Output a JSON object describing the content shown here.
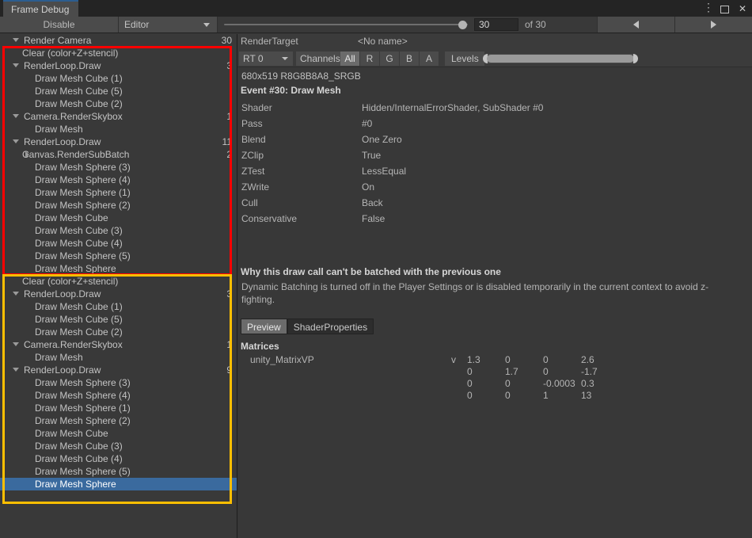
{
  "window": {
    "tab_label": "Frame Debug",
    "controls": [
      {
        "name": "more-options",
        "glyph": "⋮"
      },
      {
        "name": "maximize",
        "glyph": "□"
      },
      {
        "name": "close",
        "glyph": "✕"
      }
    ]
  },
  "toolbar": {
    "disable_label": "Disable",
    "target_dropdown": "Editor",
    "frame_value": "30",
    "frame_total_label": "of 30",
    "prev_label": "◀",
    "next_label": "▶"
  },
  "tree": {
    "rows": [
      {
        "label": "Render Camera",
        "count": "30",
        "indent": 0,
        "arrow": "down",
        "selected": false,
        "box": "none"
      },
      {
        "label": "Clear (color+Z+stencil)",
        "count": "",
        "indent": 1,
        "arrow": "none",
        "selected": false,
        "box": "red"
      },
      {
        "label": "RenderLoop.Draw",
        "count": "3",
        "indent": 0,
        "arrow": "down",
        "selected": false,
        "box": "red"
      },
      {
        "label": "Draw Mesh Cube (1)",
        "count": "",
        "indent": 2,
        "arrow": "none",
        "selected": false,
        "box": "red"
      },
      {
        "label": "Draw Mesh Cube (5)",
        "count": "",
        "indent": 2,
        "arrow": "none",
        "selected": false,
        "box": "red"
      },
      {
        "label": "Draw Mesh Cube (2)",
        "count": "",
        "indent": 2,
        "arrow": "none",
        "selected": false,
        "box": "red"
      },
      {
        "label": "Camera.RenderSkybox",
        "count": "1",
        "indent": 0,
        "arrow": "down",
        "selected": false,
        "box": "red"
      },
      {
        "label": "Draw Mesh",
        "count": "",
        "indent": 2,
        "arrow": "none",
        "selected": false,
        "box": "red"
      },
      {
        "label": "RenderLoop.Draw",
        "count": "11",
        "indent": 0,
        "arrow": "down",
        "selected": false,
        "box": "red"
      },
      {
        "label": "Canvas.RenderSubBatch",
        "count": "2",
        "indent": 1,
        "arrow": "right",
        "selected": false,
        "box": "red"
      },
      {
        "label": "Draw Mesh Sphere (3)",
        "count": "",
        "indent": 2,
        "arrow": "none",
        "selected": false,
        "box": "red"
      },
      {
        "label": "Draw Mesh Sphere (4)",
        "count": "",
        "indent": 2,
        "arrow": "none",
        "selected": false,
        "box": "red"
      },
      {
        "label": "Draw Mesh Sphere (1)",
        "count": "",
        "indent": 2,
        "arrow": "none",
        "selected": false,
        "box": "red"
      },
      {
        "label": "Draw Mesh Sphere (2)",
        "count": "",
        "indent": 2,
        "arrow": "none",
        "selected": false,
        "box": "red"
      },
      {
        "label": "Draw Mesh Cube",
        "count": "",
        "indent": 2,
        "arrow": "none",
        "selected": false,
        "box": "red"
      },
      {
        "label": "Draw Mesh Cube (3)",
        "count": "",
        "indent": 2,
        "arrow": "none",
        "selected": false,
        "box": "red"
      },
      {
        "label": "Draw Mesh Cube (4)",
        "count": "",
        "indent": 2,
        "arrow": "none",
        "selected": false,
        "box": "red"
      },
      {
        "label": "Draw Mesh Sphere (5)",
        "count": "",
        "indent": 2,
        "arrow": "none",
        "selected": false,
        "box": "red"
      },
      {
        "label": "Draw Mesh Sphere",
        "count": "",
        "indent": 2,
        "arrow": "none",
        "selected": false,
        "box": "red"
      },
      {
        "label": "Clear (color+Z+stencil)",
        "count": "",
        "indent": 1,
        "arrow": "none",
        "selected": false,
        "box": "yellow"
      },
      {
        "label": "RenderLoop.Draw",
        "count": "3",
        "indent": 0,
        "arrow": "down",
        "selected": false,
        "box": "yellow"
      },
      {
        "label": "Draw Mesh Cube (1)",
        "count": "",
        "indent": 2,
        "arrow": "none",
        "selected": false,
        "box": "yellow"
      },
      {
        "label": "Draw Mesh Cube (5)",
        "count": "",
        "indent": 2,
        "arrow": "none",
        "selected": false,
        "box": "yellow"
      },
      {
        "label": "Draw Mesh Cube (2)",
        "count": "",
        "indent": 2,
        "arrow": "none",
        "selected": false,
        "box": "yellow"
      },
      {
        "label": "Camera.RenderSkybox",
        "count": "1",
        "indent": 0,
        "arrow": "down",
        "selected": false,
        "box": "yellow"
      },
      {
        "label": "Draw Mesh",
        "count": "",
        "indent": 2,
        "arrow": "none",
        "selected": false,
        "box": "yellow"
      },
      {
        "label": "RenderLoop.Draw",
        "count": "9",
        "indent": 0,
        "arrow": "down",
        "selected": false,
        "box": "yellow"
      },
      {
        "label": "Draw Mesh Sphere (3)",
        "count": "",
        "indent": 2,
        "arrow": "none",
        "selected": false,
        "box": "yellow"
      },
      {
        "label": "Draw Mesh Sphere (4)",
        "count": "",
        "indent": 2,
        "arrow": "none",
        "selected": false,
        "box": "yellow"
      },
      {
        "label": "Draw Mesh Sphere (1)",
        "count": "",
        "indent": 2,
        "arrow": "none",
        "selected": false,
        "box": "yellow"
      },
      {
        "label": "Draw Mesh Sphere (2)",
        "count": "",
        "indent": 2,
        "arrow": "none",
        "selected": false,
        "box": "yellow"
      },
      {
        "label": "Draw Mesh Cube",
        "count": "",
        "indent": 2,
        "arrow": "none",
        "selected": false,
        "box": "yellow"
      },
      {
        "label": "Draw Mesh Cube (3)",
        "count": "",
        "indent": 2,
        "arrow": "none",
        "selected": false,
        "box": "yellow"
      },
      {
        "label": "Draw Mesh Cube (4)",
        "count": "",
        "indent": 2,
        "arrow": "none",
        "selected": false,
        "box": "yellow"
      },
      {
        "label": "Draw Mesh Sphere (5)",
        "count": "",
        "indent": 2,
        "arrow": "none",
        "selected": false,
        "box": "yellow"
      },
      {
        "label": "Draw Mesh Sphere",
        "count": "",
        "indent": 2,
        "arrow": "none",
        "selected": true,
        "box": "yellow"
      }
    ],
    "highlight_colors": {
      "first_group": "#ff0000",
      "second_group": "#ffbf00"
    },
    "selection_color": "#3a6a9e"
  },
  "detail": {
    "render_target_label": "RenderTarget",
    "render_target_value": "<No name>",
    "rt_select": "RT 0",
    "channels_label": "Channels",
    "channels": [
      "All",
      "R",
      "G",
      "B",
      "A"
    ],
    "channels_active": "All",
    "levels_label": "Levels",
    "format": "680x519 R8G8B8A8_SRGB",
    "event_title": "Event #30: Draw Mesh",
    "properties": [
      {
        "key": "Shader",
        "value": "Hidden/InternalErrorShader, SubShader #0"
      },
      {
        "key": "Pass",
        "value": "#0"
      },
      {
        "key": "Blend",
        "value": "One Zero"
      },
      {
        "key": "ZClip",
        "value": "True"
      },
      {
        "key": "ZTest",
        "value": "LessEqual"
      },
      {
        "key": "ZWrite",
        "value": "On"
      },
      {
        "key": "Cull",
        "value": "Back"
      },
      {
        "key": "Conservative",
        "value": "False"
      }
    ],
    "why_title": "Why this draw call can't be batched with the previous one",
    "why_body": "Dynamic Batching is turned off in the Player Settings or is disabled temporarily in the current context to avoid z-fighting.",
    "tabs": [
      "Preview",
      "ShaderProperties"
    ],
    "tabs_active": "Preview",
    "matrices_title": "Matrices",
    "matrix_name": "unity_MatrixVP",
    "matrix_prefix": "v",
    "matrix_rows": [
      [
        "1.3",
        "0",
        "0",
        "2.6"
      ],
      [
        "0",
        "1.7",
        "0",
        "-1.7"
      ],
      [
        "0",
        "0",
        "-0.0003",
        "0.3"
      ],
      [
        "0",
        "0",
        "1",
        "13"
      ]
    ]
  }
}
